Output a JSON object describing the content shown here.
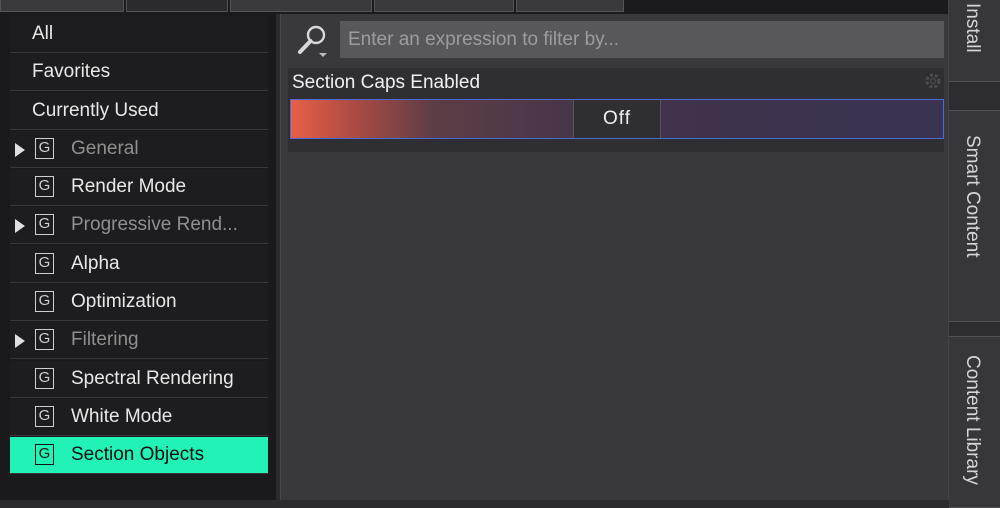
{
  "categories": [
    {
      "label": "All",
      "group": false,
      "expandable": false,
      "muted": false,
      "selected": false
    },
    {
      "label": "Favorites",
      "group": false,
      "expandable": false,
      "muted": false,
      "selected": false
    },
    {
      "label": "Currently Used",
      "group": false,
      "expandable": false,
      "muted": false,
      "selected": false
    },
    {
      "label": "General",
      "group": true,
      "expandable": true,
      "muted": true,
      "selected": false
    },
    {
      "label": "Render Mode",
      "group": true,
      "expandable": false,
      "muted": false,
      "selected": false
    },
    {
      "label": "Progressive Rend...",
      "group": true,
      "expandable": true,
      "muted": true,
      "selected": false
    },
    {
      "label": "Alpha",
      "group": true,
      "expandable": false,
      "muted": false,
      "selected": false
    },
    {
      "label": "Optimization",
      "group": true,
      "expandable": false,
      "muted": false,
      "selected": false
    },
    {
      "label": "Filtering",
      "group": true,
      "expandable": true,
      "muted": true,
      "selected": false
    },
    {
      "label": "Spectral Rendering",
      "group": true,
      "expandable": false,
      "muted": false,
      "selected": false
    },
    {
      "label": "White Mode",
      "group": true,
      "expandable": false,
      "muted": false,
      "selected": false
    },
    {
      "label": "Section Objects",
      "group": true,
      "expandable": false,
      "muted": false,
      "selected": true
    }
  ],
  "group_icon_letter": "G",
  "search": {
    "placeholder": "Enter an expression to filter by...",
    "value": ""
  },
  "property": {
    "label": "Section Caps Enabled",
    "value": "Off"
  },
  "side_tabs": [
    {
      "label": "Install"
    },
    {
      "label": "Smart Content"
    },
    {
      "label": "Content Library"
    }
  ],
  "colors": {
    "selected": "#23f2b6",
    "toggle_accent": "#e85f45",
    "toggle_border": "#4a6ad6"
  }
}
